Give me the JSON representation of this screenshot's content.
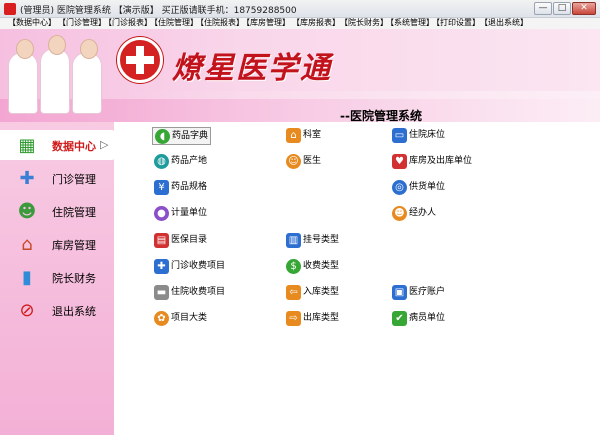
{
  "window": {
    "title": "(管理员) 医院管理系统 【演示版】 买正版请联手机：18759288500",
    "min_glyph": "—",
    "max_glyph": "□",
    "close_glyph": "✕"
  },
  "menu": [
    "【数据中心】",
    "【门诊管理】",
    "【门诊报表】",
    "【住院管理】",
    "【住院报表】",
    "【库房管理】",
    "【库房报表】",
    "【院长财务】",
    "【系统管理】",
    "【打印设置】",
    "【退出系统】"
  ],
  "banner": {
    "brand": "燎星医学通",
    "subtitle": "--医院管理系统"
  },
  "sidebar": {
    "items": [
      {
        "label": "数据中心",
        "icon": "blocks-icon",
        "glyph": "▦",
        "active": true,
        "arrow": "▷"
      },
      {
        "label": "门诊管理",
        "icon": "clinic-icon",
        "glyph": "✚",
        "active": false
      },
      {
        "label": "住院管理",
        "icon": "inpatient-icon",
        "glyph": "☻",
        "active": false
      },
      {
        "label": "库房管理",
        "icon": "warehouse-icon",
        "glyph": "⌂",
        "active": false
      },
      {
        "label": "院长财务",
        "icon": "finance-chart-icon",
        "glyph": "▮",
        "active": false
      },
      {
        "label": "退出系统",
        "icon": "exit-icon",
        "glyph": "⊘",
        "active": false
      }
    ]
  },
  "shortcuts": {
    "col1": [
      {
        "label": "药品字典",
        "icon": "pill-icon",
        "glyph": "◖",
        "color": "green"
      },
      {
        "label": "药品产地",
        "icon": "globe-icon",
        "glyph": "◍",
        "color": "teal"
      },
      {
        "label": "药品规格",
        "icon": "spec-icon",
        "glyph": "¥",
        "color": "blue"
      },
      {
        "label": "计量单位",
        "icon": "unit-icon",
        "glyph": "●",
        "color": "purple"
      },
      {
        "label": "医保目录",
        "icon": "catalog-book-icon",
        "glyph": "▤",
        "color": "red"
      },
      {
        "label": "门诊收费项目",
        "icon": "clinic-fee-icon",
        "glyph": "✚",
        "color": "blue"
      },
      {
        "label": "住院收费项目",
        "icon": "ambulance-icon",
        "glyph": "▬",
        "color": "gray"
      },
      {
        "label": "项目大类",
        "icon": "gear-icon",
        "glyph": "✿",
        "color": "orange"
      }
    ],
    "col2": [
      {
        "label": "科室",
        "icon": "house-icon",
        "glyph": "⌂",
        "color": "orange"
      },
      {
        "label": "医生",
        "icon": "doctor-icon",
        "glyph": "☺",
        "color": "orange"
      },
      {
        "label": "挂号类型",
        "icon": "register-doc-icon",
        "glyph": "▥",
        "color": "blue"
      },
      {
        "label": "收费类型",
        "icon": "dollar-icon",
        "glyph": "$",
        "color": "green"
      },
      {
        "label": "入库类型",
        "icon": "stock-in-icon",
        "glyph": "⇦",
        "color": "orange"
      },
      {
        "label": "出库类型",
        "icon": "stock-out-icon",
        "glyph": "⇨",
        "color": "orange"
      }
    ],
    "col3": [
      {
        "label": "住院床位",
        "icon": "bed-icon",
        "glyph": "▭",
        "color": "blue"
      },
      {
        "label": "库房及出库单位",
        "icon": "heart-warehouse-icon",
        "glyph": "♥",
        "color": "red"
      },
      {
        "label": "供货单位",
        "icon": "supplier-globe-icon",
        "glyph": "◎",
        "color": "blue"
      },
      {
        "label": "经办人",
        "icon": "handler-people-icon",
        "glyph": "☻",
        "color": "orange"
      },
      {
        "label": "医疗账户",
        "icon": "medical-account-icon",
        "glyph": "▣",
        "color": "blue"
      },
      {
        "label": "病员单位",
        "icon": "checkbox-icon",
        "glyph": "✔",
        "color": "green"
      }
    ]
  }
}
